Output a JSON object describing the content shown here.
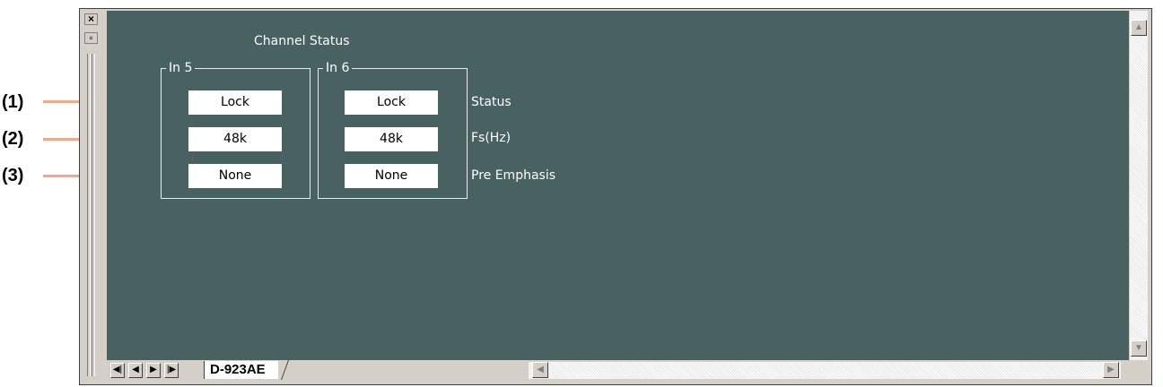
{
  "callouts": [
    {
      "label": "(1)"
    },
    {
      "label": "(2)"
    },
    {
      "label": "(3)"
    }
  ],
  "window": {
    "close_glyph": "×",
    "restore_glyph": "▫"
  },
  "panel": {
    "title": "Channel Status",
    "groups": [
      {
        "name": "In 5",
        "status": "Lock",
        "fs": "48k",
        "pre_emphasis": "None"
      },
      {
        "name": "In 6",
        "status": "Lock",
        "fs": "48k",
        "pre_emphasis": "None"
      }
    ],
    "row_labels": {
      "status": "Status",
      "fs": "Fs(Hz)",
      "pre_emphasis": "Pre Emphasis"
    }
  },
  "sheet_nav": {
    "first": "◀|",
    "prev": "◀",
    "next": "▶",
    "last": "|▶"
  },
  "sheet_tabs": [
    {
      "label": "D-923AE"
    }
  ],
  "scroll": {
    "up": "▲",
    "down": "▼",
    "left": "◀",
    "right": "▶"
  },
  "colors": {
    "panel_bg": "#476261",
    "callout_line": "#f2a98b",
    "value_box_bg": "#ffffff"
  }
}
